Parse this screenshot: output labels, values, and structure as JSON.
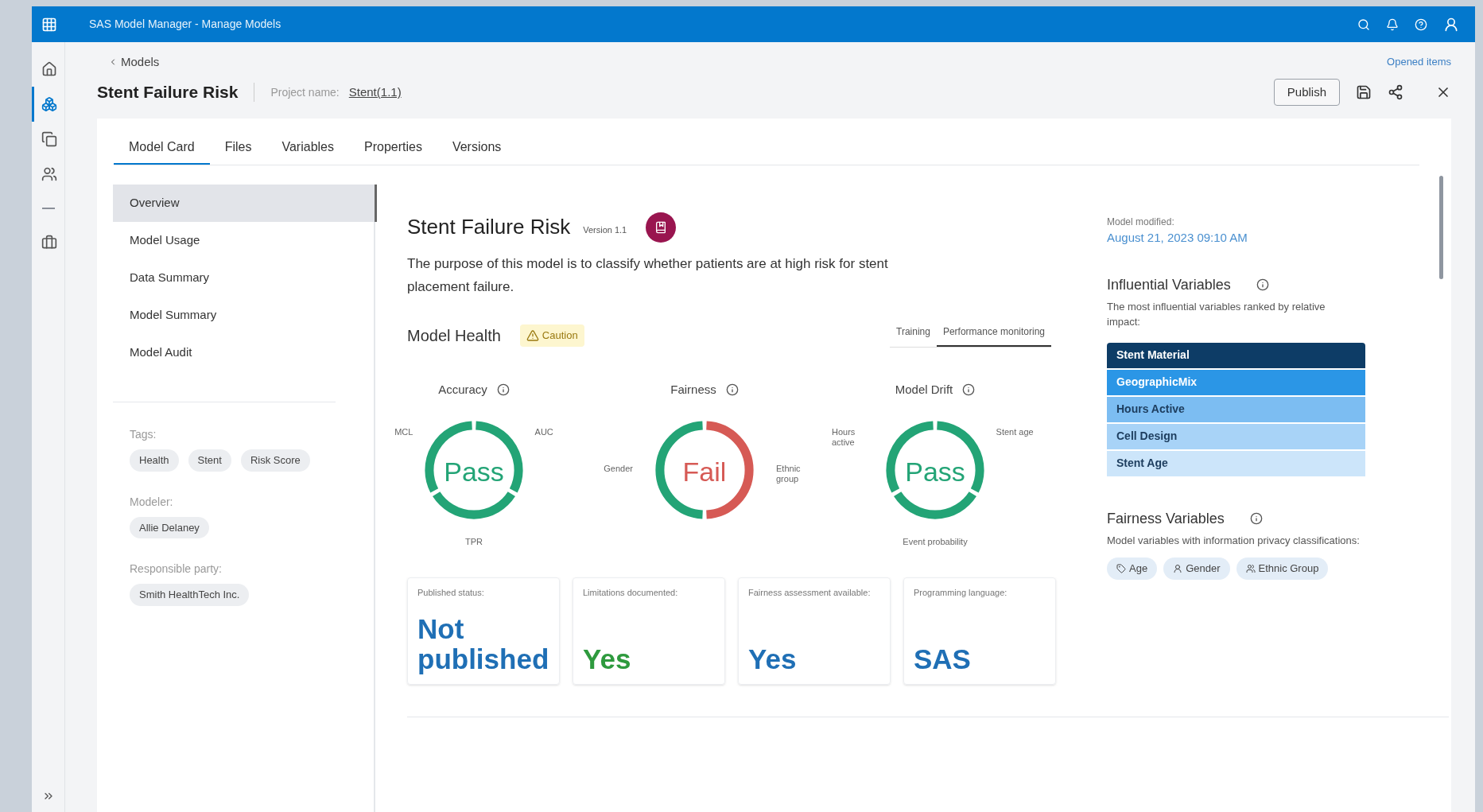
{
  "app_bar": {
    "title": "SAS Model Manager - Manage Models"
  },
  "rail": [
    {
      "kind": "home",
      "selected": false
    },
    {
      "kind": "models",
      "selected": true
    },
    {
      "kind": "copy",
      "selected": false
    },
    {
      "kind": "people",
      "selected": false
    },
    {
      "kind": "divider"
    },
    {
      "kind": "briefcase",
      "selected": false
    }
  ],
  "header": {
    "back_link": "Models",
    "opened_items": "Opened items",
    "title": "Stent Failure Risk",
    "project_label": "Project name:",
    "project_link": "Stent(1.1)",
    "publish_button": "Publish"
  },
  "tabs": [
    {
      "label": "Model Card",
      "selected": true
    },
    {
      "label": "Files",
      "selected": false
    },
    {
      "label": "Variables",
      "selected": false
    },
    {
      "label": "Properties",
      "selected": false
    },
    {
      "label": "Versions",
      "selected": false
    }
  ],
  "sidebar": {
    "items": [
      {
        "label": "Overview",
        "selected": true
      },
      {
        "label": "Model Usage",
        "selected": false
      },
      {
        "label": "Data Summary",
        "selected": false
      },
      {
        "label": "Model Summary",
        "selected": false
      },
      {
        "label": "Model Audit",
        "selected": false
      }
    ],
    "groups": [
      {
        "label": "Tags:",
        "chips": [
          "Health",
          "Stent",
          "Risk Score"
        ]
      },
      {
        "label": "Modeler:",
        "chips": [
          "Allie Delaney"
        ]
      },
      {
        "label": "Responsible party:",
        "chips": [
          "Smith HealthTech Inc."
        ]
      }
    ]
  },
  "overview": {
    "title": "Stent Failure Risk",
    "version": "Version 1.1",
    "description": "The purpose of this model is to classify whether patients are at high risk for stent placement failure.",
    "health_title": "Model Health",
    "health_badge": "Caution",
    "views": [
      {
        "label": "Training",
        "selected": false
      },
      {
        "label": "Performance monitoring",
        "selected": true
      }
    ],
    "gauges": [
      {
        "title": "Accuracy",
        "result": "Pass",
        "color": "#23a476",
        "segments": [
          {
            "label": "MCL",
            "color": "#23a476"
          },
          {
            "label": "AUC",
            "color": "#23a476"
          },
          {
            "label": "TPR",
            "color": "#23a476"
          }
        ]
      },
      {
        "title": "Fairness",
        "result": "Fail",
        "color": "#d65a55",
        "segments": [
          {
            "label": "Gender",
            "color": "#23a476"
          },
          {
            "label": "Ethnic group",
            "color": "#d65a55"
          }
        ]
      },
      {
        "title": "Model Drift",
        "result": "Pass",
        "color": "#23a476",
        "segments": [
          {
            "label": "Hours active",
            "color": "#23a476"
          },
          {
            "label": "Stent age",
            "color": "#23a476"
          },
          {
            "label": "Event probability",
            "color": "#23a476"
          }
        ]
      }
    ],
    "cards": [
      {
        "label": "Published status:",
        "value": "Not published",
        "color": "#1f6fb5"
      },
      {
        "label": "Limitations documented:",
        "value": "Yes",
        "color": "#2e9a3e"
      },
      {
        "label": "Fairness assessment available:",
        "value": "Yes",
        "color": "#1f6fb5"
      },
      {
        "label": "Programming language:",
        "value": "SAS",
        "color": "#1f6fb5"
      }
    ]
  },
  "details": {
    "modified_label": "Model modified:",
    "modified_value": "August 21, 2023 09:10 AM",
    "influential_title": "Influential Variables",
    "influential_desc": "The most influential variables ranked by relative impact:",
    "influential": [
      {
        "label": "Stent Material",
        "color": "#0d3c66"
      },
      {
        "label": "GeographicMix",
        "color": "#2b96e6"
      },
      {
        "label": "Hours Active",
        "color": "#7cbdf2"
      },
      {
        "label": "Cell Design",
        "color": "#a8d3f7"
      },
      {
        "label": "Stent Age",
        "color": "#cce5fa"
      }
    ],
    "fairness_title": "Fairness Variables",
    "fairness_desc": "Model variables with information privacy classifications:",
    "fairness_chips": [
      {
        "label": "Age",
        "kind": "tag"
      },
      {
        "label": "Gender",
        "kind": "person"
      },
      {
        "label": "Ethnic Group",
        "kind": "people"
      }
    ]
  }
}
